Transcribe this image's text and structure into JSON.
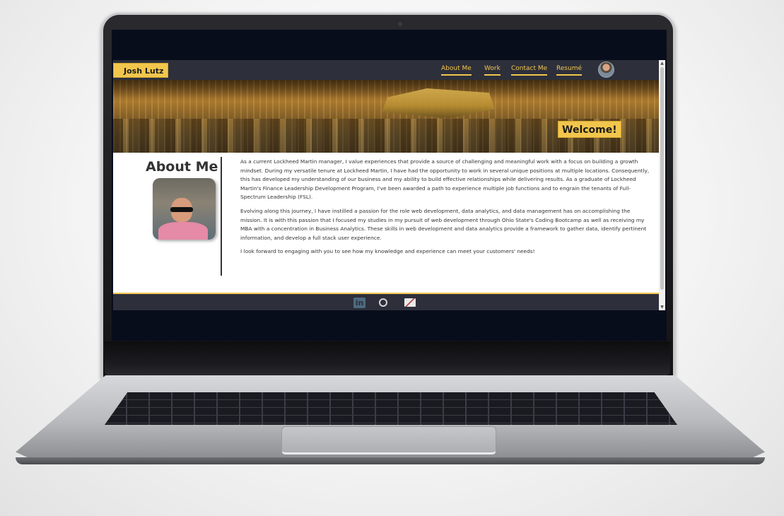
{
  "site": {
    "brand": "Josh Lutz",
    "nav": [
      "About Me",
      "Work",
      "Contact Me",
      "Resumé"
    ],
    "hero_title": "Welcome!",
    "about": {
      "title": "About Me",
      "paragraphs": [
        "As a current Lockheed Martin manager, I value experiences that provide a source of challenging and meaningful work with a focus on building a growth mindset. During my versatile tenure at Lockheed Martin, I have had the opportunity to work in several unique positions at multiple locations. Consequently, this has developed my understanding of our business and my ability to build effective relationships while delivering results. As a graduate of Lockheed Martin's Finance Leadership Development Program, I've been awarded a path to experience multiple job functions and to engrain the tenants of Full-Spectrum Leadership (FSL).",
        "Evolving along this journey, I have instilled a passion for the role web development, data analytics, and data management has on accomplishing the mission. It is with this passion that I focused my studies in my pursuit of web development through Ohio State's Coding Bootcamp as well as receiving my MBA with a concentration in Business Analytics. These skills in web development and data analytics provide a framework to gather data, identify pertinent information, and develop a full stack user experience.",
        "I look forward to engaging with you to see how my knowledge and experience can meet your customers' needs!"
      ]
    },
    "footer_icons": [
      "linkedin-icon",
      "github-icon",
      "mail-icon"
    ],
    "colors": {
      "accent": "#f2c64d",
      "nav_bg": "#2d2f3b",
      "text": "#333333"
    }
  }
}
